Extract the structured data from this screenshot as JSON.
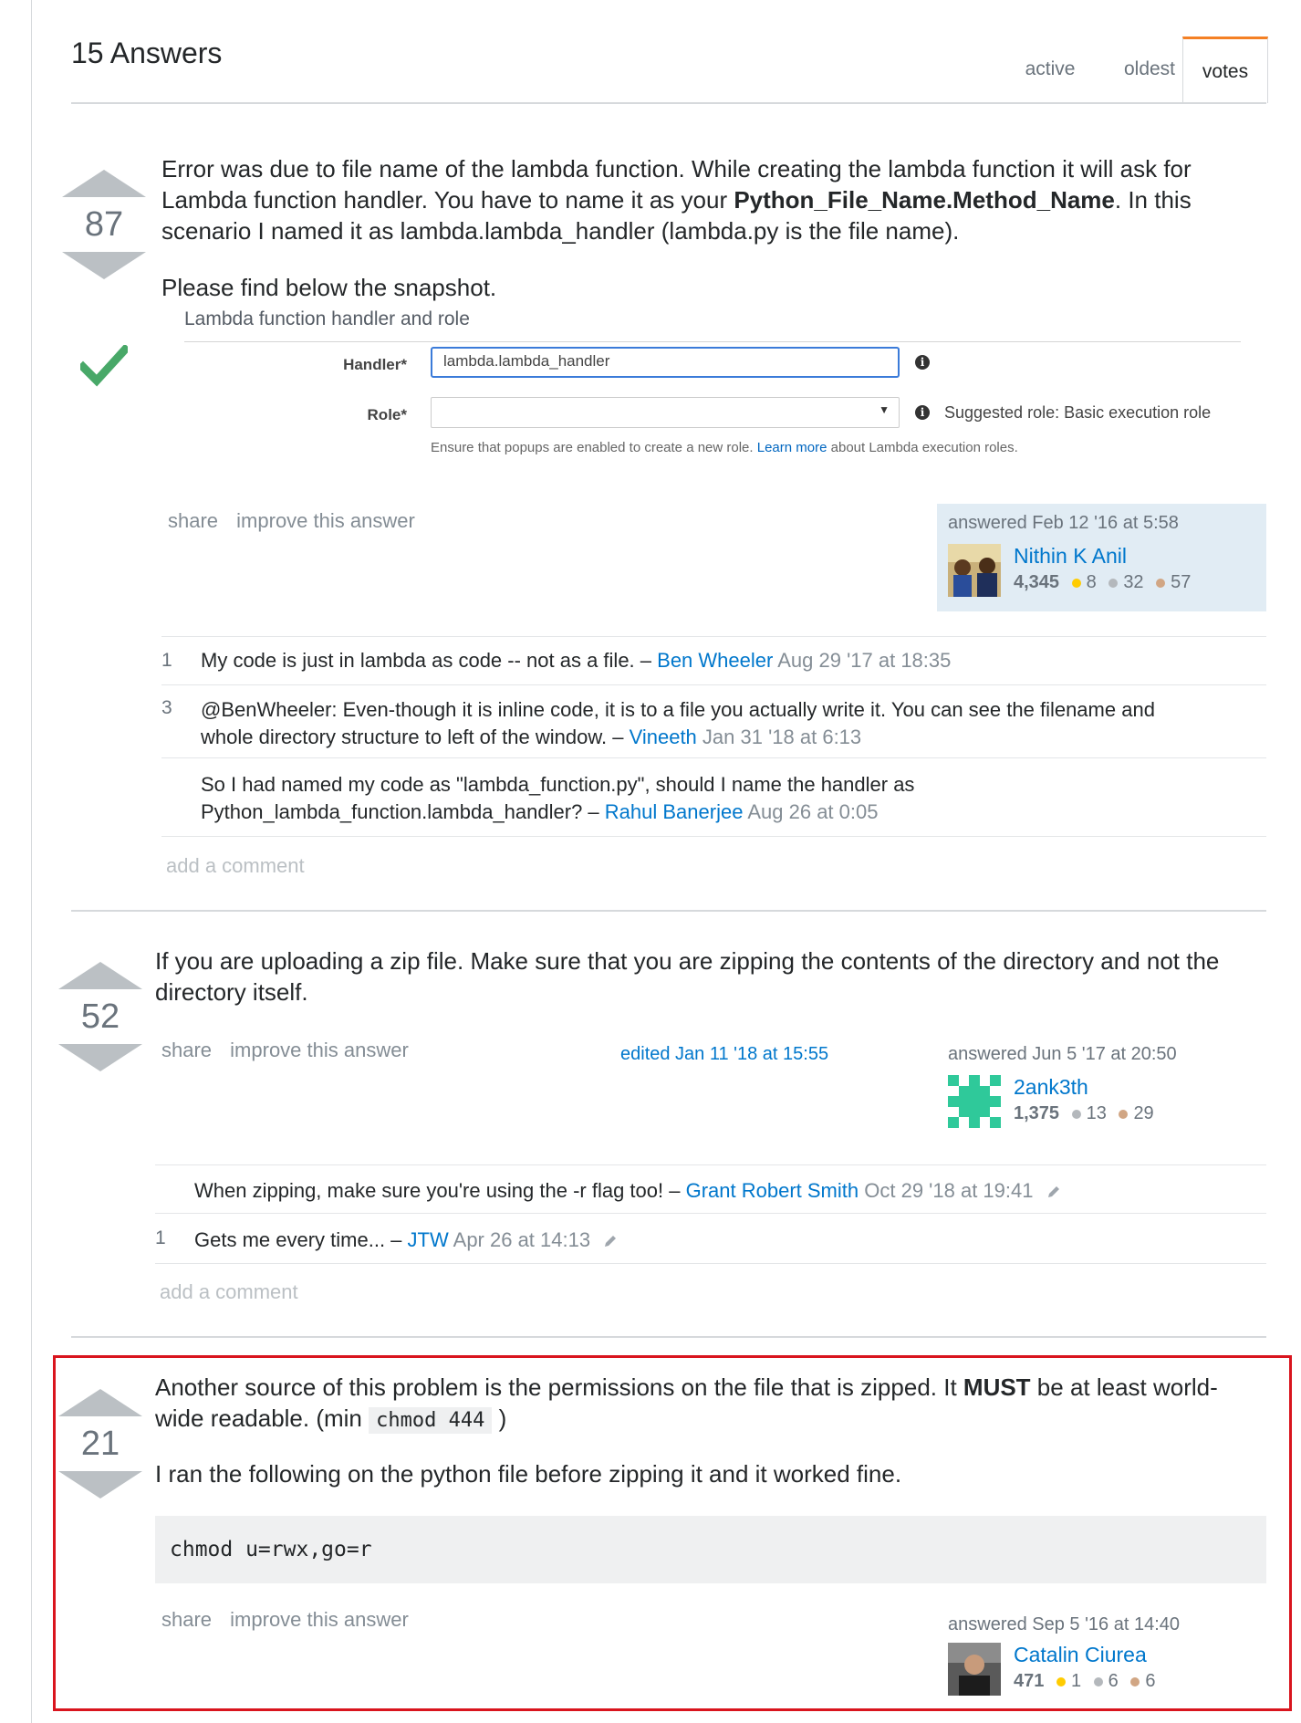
{
  "header": {
    "answer_count": "15 Answers",
    "tabs": [
      {
        "label": "active"
      },
      {
        "label": "oldest"
      },
      {
        "label": "votes",
        "selected": true
      }
    ]
  },
  "answers": [
    {
      "votes": "87",
      "accepted": true,
      "body": {
        "p1_a": "Error was due to file name of the lambda function. While creating the lambda function it will ask for Lambda function handler. You have to name it as your ",
        "p1_bold": "Python_File_Name.Method_Name",
        "p1_b": ". In this scenario I named it as lambda.lambda_handler (lambda.py is the file name).",
        "p2": "Please find below the snapshot."
      },
      "snapshot": {
        "section_title": "Lambda function handler and role",
        "handler_label": "Handler*",
        "handler_value": "lambda.lambda_handler",
        "role_label": "Role*",
        "role_hint": "Suggested role: Basic execution role",
        "note_a": "Ensure that popups are enabled to create a new role.",
        "note_link": "Learn more",
        "note_b": "about Lambda execution roles."
      },
      "menu": {
        "share": "share",
        "improve": "improve this answer"
      },
      "signature": {
        "action": "answered Feb 12 '16 at 5:58",
        "user": "Nithin K Anil",
        "rep": "4,345",
        "gold": "8",
        "silver": "32",
        "bronze": "57"
      },
      "comments": [
        {
          "score": "1",
          "text": "My code is just in lambda as code -- not as a file. –",
          "user": "Ben Wheeler",
          "date": "Aug 29 '17 at 18:35"
        },
        {
          "score": "3",
          "text_line1": "@BenWheeler: Even-though it is inline code, it is to a file you actually write it. You can see the filename and",
          "text_line2": "whole directory structure to left of the window. –",
          "user": "Vineeth",
          "date": "Jan 31 '18 at 6:13"
        },
        {
          "score": "",
          "text_line1": "So I had named my code as \"lambda_function.py\", should I name the handler as",
          "text_line2": "Python_lambda_function.lambda_handler? –",
          "user": "Rahul Banerjee",
          "date": "Aug 26 at 0:05"
        }
      ],
      "add_comment": "add a comment"
    },
    {
      "votes": "52",
      "body": {
        "p1_line1": "If you are uploading a zip file. Make sure that you are zipping the contents of the directory and not the",
        "p1_line2": "directory itself."
      },
      "menu": {
        "share": "share",
        "improve": "improve this answer"
      },
      "edited": "edited Jan 11 '18 at 15:55",
      "signature": {
        "action": "answered Jun 5 '17 at 20:50",
        "user": "2ank3th",
        "rep": "1,375",
        "silver": "13",
        "bronze": "29"
      },
      "comments": [
        {
          "score": "",
          "text": "When zipping, make sure you're using the -r flag too! –",
          "user": "Grant Robert Smith",
          "date": "Oct 29 '18 at 19:41"
        },
        {
          "score": "1",
          "text": "Gets me every time... –",
          "user": "JTW",
          "date": "Apr 26 at 14:13"
        }
      ],
      "add_comment": "add a comment"
    },
    {
      "votes": "21",
      "body": {
        "p1_a": "Another source of this problem is the permissions on the file that is zipped. It ",
        "p1_bold": "MUST",
        "p1_b": " be at least world-",
        "p1_c": "wide readable. (min ",
        "p1_code": "chmod 444",
        "p1_d": " )",
        "p2": "I ran the following on the python file before zipping it and it worked fine.",
        "code": "chmod u=rwx,go=r"
      },
      "menu": {
        "share": "share",
        "improve": "improve this answer"
      },
      "signature": {
        "action": "answered Sep 5 '16 at 14:40",
        "user": "Catalin Ciurea",
        "rep": "471",
        "gold": "1",
        "silver": "6",
        "bronze": "6"
      }
    }
  ],
  "colors": {
    "accent": "#f48024",
    "link": "#0077cc",
    "accepted": "#48a868",
    "highlight": "#d9151e"
  }
}
